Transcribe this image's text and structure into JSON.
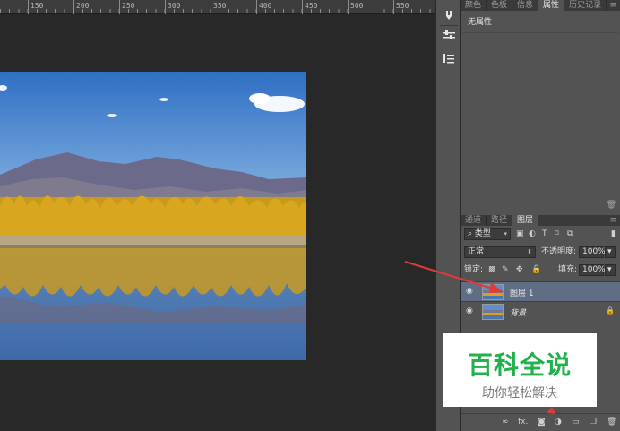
{
  "ruler": {
    "ticks": [
      "150",
      "200",
      "250",
      "300",
      "350",
      "400",
      "450",
      "500",
      "550"
    ]
  },
  "toolstrip": {
    "icons": [
      "brush-preset-icon",
      "adjust-sliders-icon",
      "character-style-icon"
    ]
  },
  "props_panel": {
    "tabs": [
      "颜色",
      "色板",
      "信息",
      "属性",
      "历史记录"
    ],
    "active_tab": "属性",
    "title": "无属性"
  },
  "layers_panel": {
    "tabs": [
      "通道",
      "路径",
      "图层"
    ],
    "active_tab": "图层",
    "filter_label": "类型",
    "blend_mode": "正常",
    "opacity_label": "不透明度:",
    "opacity_value": "100%",
    "lock_label": "锁定:",
    "fill_label": "填充:",
    "fill_value": "100%",
    "layers": [
      {
        "name": "图层 1",
        "selected": true
      },
      {
        "name": "背景",
        "selected": false
      }
    ],
    "footer_icons": [
      "link-icon",
      "fx-icon",
      "mask-icon",
      "adjustment-icon",
      "folder-icon",
      "new-layer-icon",
      "trash-icon"
    ],
    "footer_fx": "fx."
  },
  "watermark": {
    "title": "百科全说",
    "subtitle": "助你轻松解决"
  },
  "colors": {
    "selection": "#5f6e84",
    "panel": "#535353",
    "annotation_arrow": "#e53935",
    "watermark_green": "#21b24c"
  }
}
